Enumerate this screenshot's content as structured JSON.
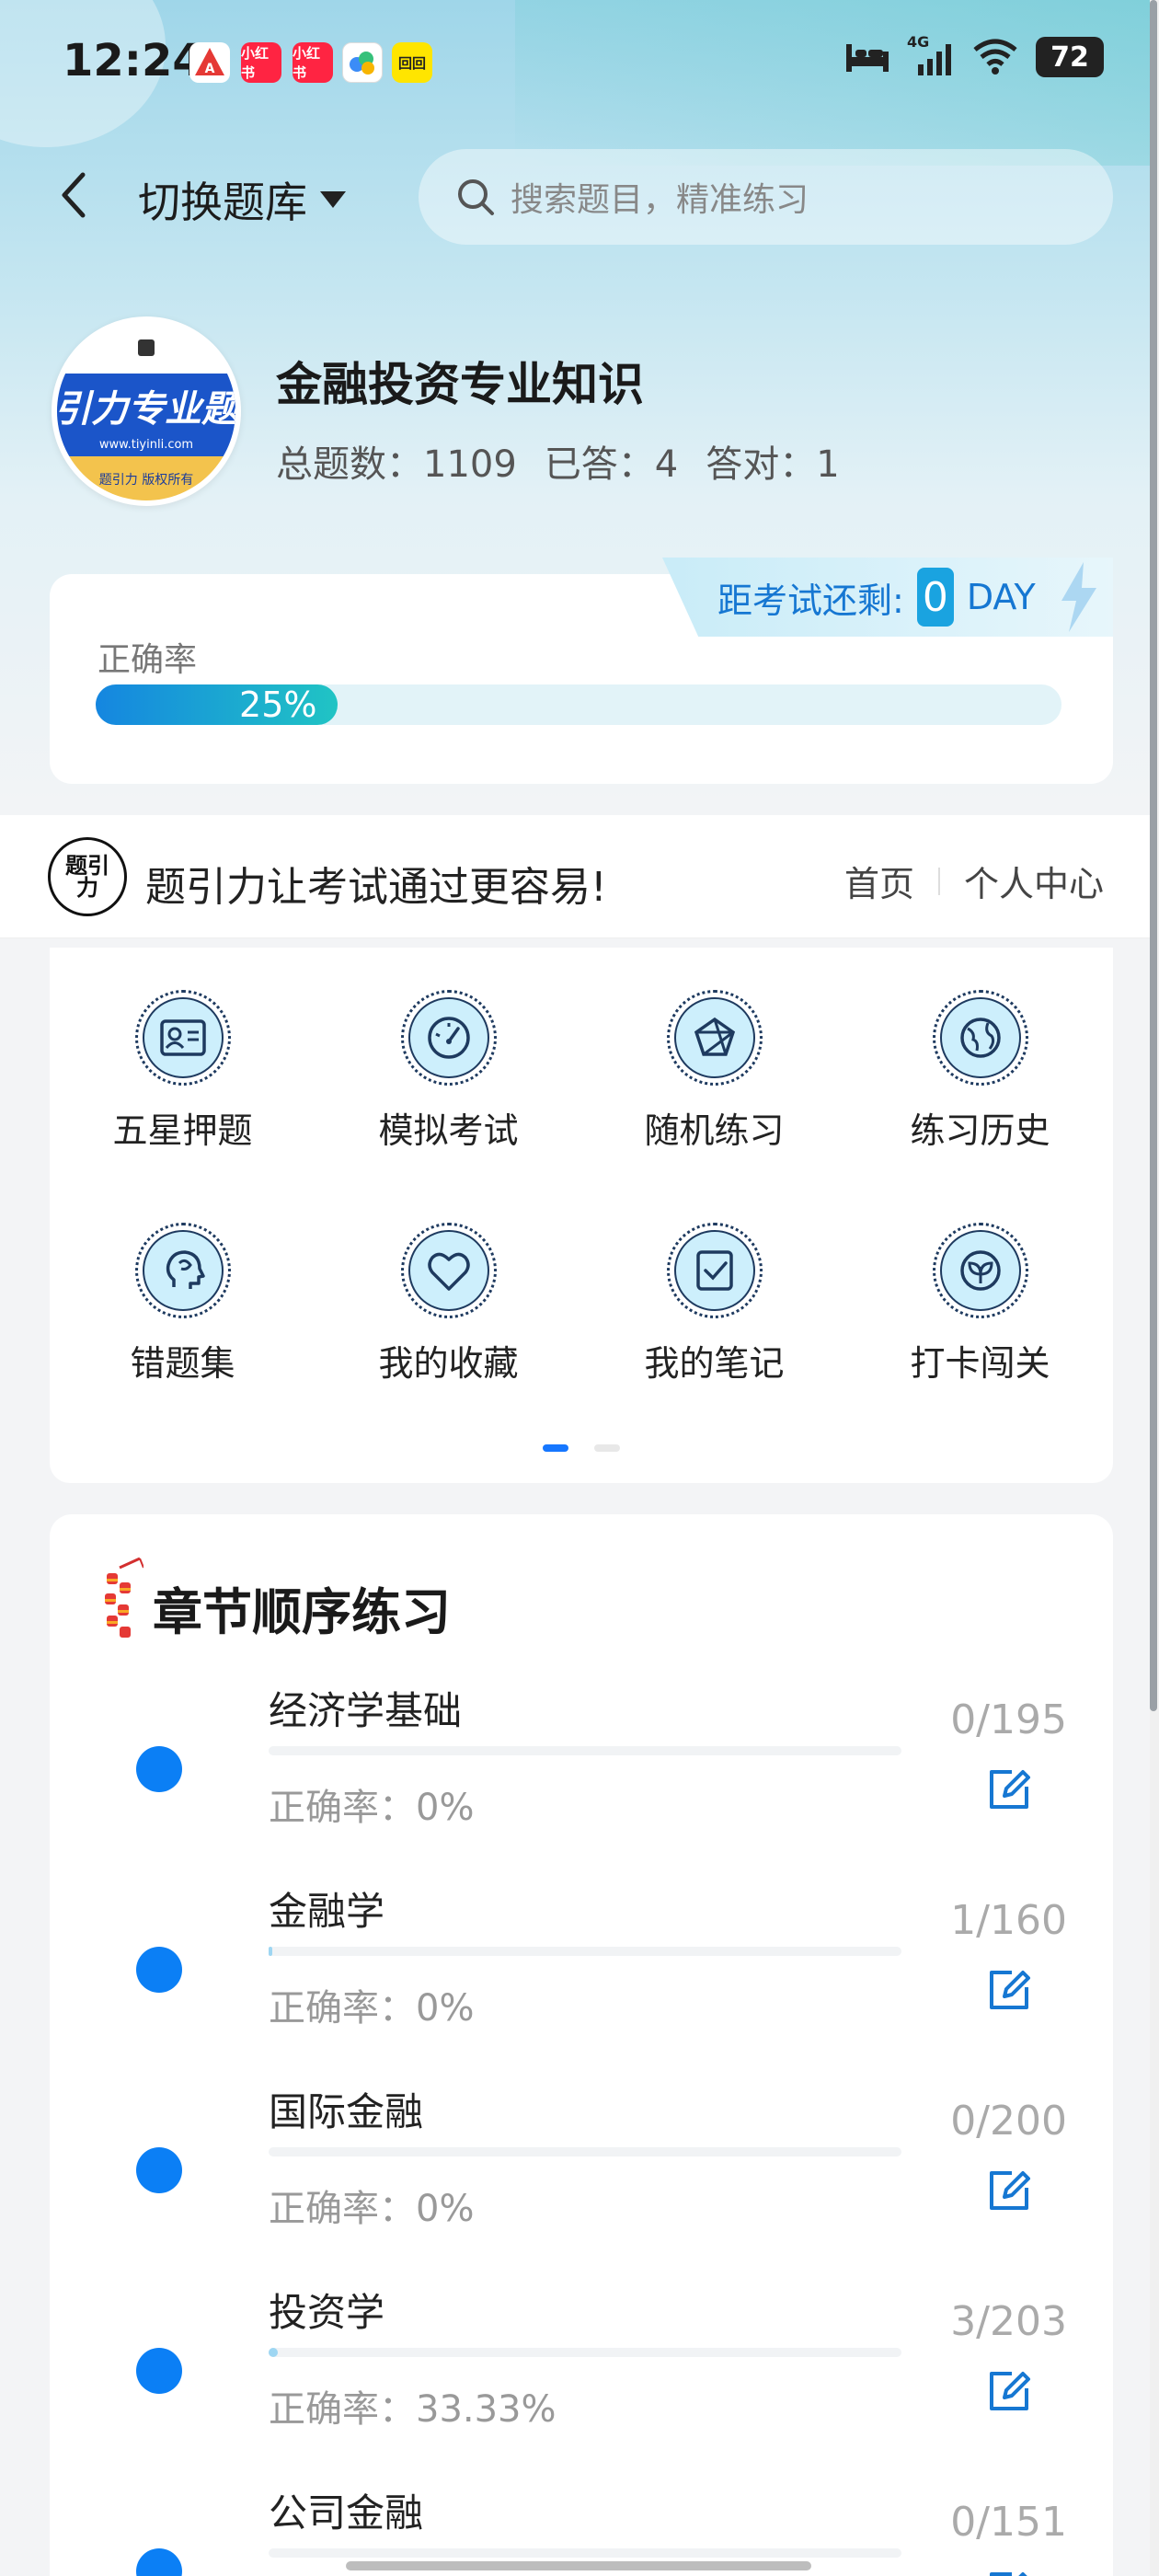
{
  "status_bar": {
    "time": "12:24",
    "notifications": [
      "小红书",
      "小红书",
      "回回"
    ],
    "network": "4G",
    "battery": "72"
  },
  "nav": {
    "switch_label": "切换题库",
    "search_placeholder": "搜索题目，精准练习"
  },
  "profile": {
    "logo_main": "引力专业题",
    "logo_url": "www.tiyinli.com",
    "logo_footer": "题引力 版权所有",
    "title": "金融投资专业知识",
    "total_label": "总题数：1109",
    "answered_label": "已答：4",
    "correct_label": "答对：1"
  },
  "accuracy": {
    "countdown_label": "距考试还剩:",
    "days": "0",
    "day_unit": "DAY",
    "label": "正确率",
    "value_text": "25%",
    "value": 0.25
  },
  "slogan": {
    "logo_text": "题引力",
    "text": "题引力让考试通过更容易!",
    "nav_home": "首页",
    "nav_profile": "个人中心"
  },
  "features": [
    {
      "label": "五星押题",
      "icon": "id-card-icon"
    },
    {
      "label": "模拟考试",
      "icon": "gauge-icon"
    },
    {
      "label": "随机练习",
      "icon": "network-icon"
    },
    {
      "label": "练习历史",
      "icon": "globe-icon"
    },
    {
      "label": "错题集",
      "icon": "head-icon"
    },
    {
      "label": "我的收藏",
      "icon": "heart-icon"
    },
    {
      "label": "我的笔记",
      "icon": "checklist-icon"
    },
    {
      "label": "打卡闯关",
      "icon": "sprout-icon"
    }
  ],
  "chapters_title": "章节顺序练习",
  "chapters": [
    {
      "name": "经济学基础",
      "accuracy": "正确率：0%",
      "count": "0/195",
      "progress": 0.0
    },
    {
      "name": "金融学",
      "accuracy": "正确率：0%",
      "count": "1/160",
      "progress": 0.00625
    },
    {
      "name": "国际金融",
      "accuracy": "正确率：0%",
      "count": "0/200",
      "progress": 0.0
    },
    {
      "name": "投资学",
      "accuracy": "正确率：33.33%",
      "count": "3/203",
      "progress": 0.0148
    },
    {
      "name": "公司金融",
      "accuracy": "",
      "count": "0/151",
      "progress": 0.0
    }
  ],
  "colors": {
    "accent": "#1677ff",
    "chapter_dot": "#0b7ff5",
    "progress_start": "#1586e0",
    "progress_end": "#20c4c4"
  }
}
